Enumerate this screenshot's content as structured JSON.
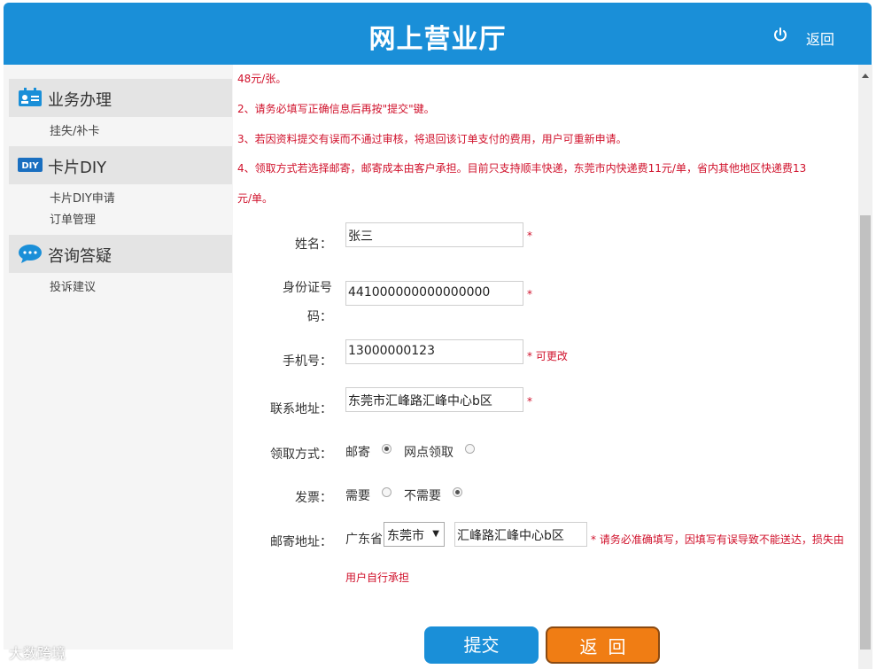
{
  "header": {
    "title": "网上营业厅",
    "back_label": "返回",
    "power_icon": "power-icon"
  },
  "sidebar": {
    "sections": [
      {
        "label": "业务办理",
        "icon": "id-card-icon",
        "items": [
          "挂失/补卡"
        ]
      },
      {
        "label": "卡片DIY",
        "icon": "diy-icon",
        "items": [
          "卡片DIY申请",
          "订单管理"
        ]
      },
      {
        "label": "咨询答疑",
        "icon": "chat-bubble-icon",
        "items": [
          "投诉建议"
        ]
      }
    ]
  },
  "notes": {
    "line0": "48元/张。",
    "line2": "2、请务必填写正确信息后再按\"提交\"键。",
    "line3": "3、若因资料提交有误而不通过审核，将退回该订单支付的费用，用户可重新申请。",
    "line4a": "4、领取方式若选择邮寄，邮寄成本由客户承担。目前只支持顺丰快递，东莞市内快递费11元/单，省内其他地区快递费13",
    "line4b": "元/单。"
  },
  "form": {
    "name": {
      "label": "姓名：",
      "value": "张三",
      "mark": "*"
    },
    "id_number": {
      "label_line1": "身份证号",
      "label_line2": "码：",
      "value": "441000000000000000",
      "mark": "*"
    },
    "phone": {
      "label": "手机号：",
      "value": "13000000123",
      "mark": "* 可更改"
    },
    "address": {
      "label": "联系地址：",
      "value": "东莞市汇峰路汇峰中心b区",
      "mark": "*"
    },
    "pickup": {
      "label": "领取方式：",
      "option1": "邮寄",
      "option2": "网点领取",
      "selected": "邮寄"
    },
    "invoice": {
      "label": "发票：",
      "option1": "需要",
      "option2": "不需要",
      "selected": "不需要"
    },
    "mail_address": {
      "label": "邮寄地址：",
      "province": "广东省",
      "city": "东莞市",
      "street": "汇峰路汇峰中心b区",
      "note_line1": "* 请务必准确填写，因填写有误导致不能送达，损失由",
      "note_line2": "用户自行承担"
    }
  },
  "buttons": {
    "submit": "提交",
    "back": "返回"
  },
  "watermark": "大数跨境",
  "colors": {
    "header": "#1a8fd8",
    "submit": "#1a8fd8",
    "back": "#f07d14",
    "note": "#d0112b"
  }
}
